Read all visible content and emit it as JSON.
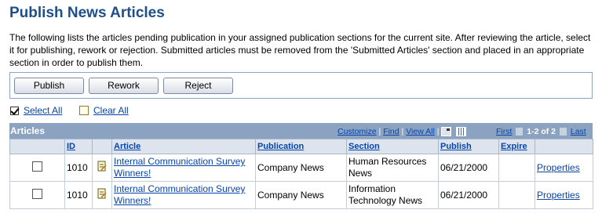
{
  "page": {
    "title": "Publish News Articles",
    "description": "The following lists the articles pending publication in your assigned publication sections for the current site. After reviewing the article, select it for publishing, rework or rejection. Submitted articles must be removed from the 'Submitted Articles' section and placed in an appropriate section in order to publish them."
  },
  "toolbar": {
    "publish_label": "Publish",
    "rework_label": "Rework",
    "reject_label": "Reject"
  },
  "selection": {
    "select_all": "Select All",
    "clear_all": "Clear All"
  },
  "grid": {
    "title": "Articles",
    "customize": "Customize",
    "find": "Find",
    "view_all": "View All",
    "first": "First",
    "range": "1-2 of 2",
    "last": "Last",
    "columns": [
      "ID",
      "Article",
      "Publication",
      "Section",
      "Publish",
      "Expire"
    ],
    "rows": [
      {
        "id": "1010",
        "article": "Internal Communication Survey Winners!",
        "publication": "Company News",
        "section": "Human Resources News",
        "publish": "06/21/2000",
        "expire": "",
        "properties": "Properties"
      },
      {
        "id": "1010",
        "article": "Internal Communication Survey Winners!",
        "publication": "Company News",
        "section": "Information Technology News",
        "publish": "06/21/2000",
        "expire": "",
        "properties": "Properties"
      }
    ]
  },
  "colors": {
    "title": "#1f4e8c",
    "grid_header": "#8ba3c1",
    "link": "#0645ad"
  }
}
